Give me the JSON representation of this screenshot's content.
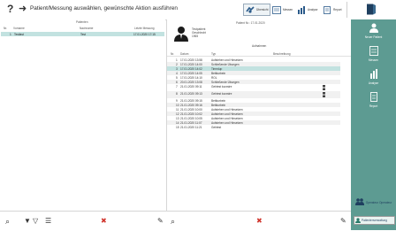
{
  "header": {
    "help_icon": "question-icon",
    "title": "Patient/Messung auswählen, gewünschte Aktion ausführen",
    "buttons": [
      {
        "label": "Übersicht",
        "icon": "handshake-icon",
        "active": true
      },
      {
        "label": "Messen",
        "icon": "measure-icon",
        "active": false
      },
      {
        "label": "Analyse",
        "icon": "bar-chart-icon",
        "active": false
      },
      {
        "label": "Report",
        "icon": "report-icon",
        "active": false
      }
    ],
    "exit_icon": "exit-icon"
  },
  "patients": {
    "header": "Patienten",
    "columns": [
      "Nr.",
      "Vorname",
      "Nachname",
      "Letzte Messung"
    ],
    "rows": [
      {
        "nr": "1",
        "vorname": "Testlast",
        "nachname": "Test",
        "letzte": "17.01.2020 17:15"
      }
    ]
  },
  "patient_detail": {
    "date": "Patient Nr.: 17.01.2020",
    "name_lines": [
      "Testpatient",
      "Geschlecht",
      "1965"
    ],
    "measurements_title": "Aufnahmen",
    "columns": [
      "Nr.",
      "Datum",
      "Typ",
      "Beschreibung"
    ],
    "rows": [
      {
        "nr": "1",
        "datum": "17.01.2020 13:58",
        "typ": "Aufstehen und Hinsetzen",
        "cam": false
      },
      {
        "nr": "2",
        "datum": "17.01.2020 14:00",
        "typ": "Schließende Übungen",
        "cam": false
      },
      {
        "nr": "3",
        "datum": "17.01.2020 14:02",
        "typ": "Timedup",
        "cam": false
      },
      {
        "nr": "4",
        "datum": "17.01.2020 14:05",
        "typ": "Bettkurbeln",
        "cam": false
      },
      {
        "nr": "5",
        "datum": "17.01.2020 14:10",
        "typ": "ROL",
        "cam": false
      },
      {
        "nr": "6",
        "datum": "20.01.2020 13:08",
        "typ": "Schließende Übungen",
        "cam": false
      },
      {
        "nr": "7",
        "datum": "21.01.2020 09:11",
        "typ": "Gehtest kurzstre",
        "cam": true
      },
      {
        "nr": "8",
        "datum": "21.01.2020 09:13",
        "typ": "Gehtest kurzstre",
        "cam": true
      },
      {
        "nr": "9",
        "datum": "21.01.2020 09:15",
        "typ": "Bettkurbeln",
        "cam": false
      },
      {
        "nr": "10",
        "datum": "21.01.2020 09:16",
        "typ": "Bettkurbeln",
        "cam": false
      },
      {
        "nr": "11",
        "datum": "21.01.2020 10:00",
        "typ": "Aufstehen und Hinsetzen",
        "cam": false
      },
      {
        "nr": "12",
        "datum": "21.01.2020 10:02",
        "typ": "Aufstehen und Hinsetzen",
        "cam": false
      },
      {
        "nr": "13",
        "datum": "21.01.2020 10:05",
        "typ": "Aufstehen und Hinsetzen",
        "cam": false
      },
      {
        "nr": "14",
        "datum": "21.01.2020 11:07",
        "typ": "Aufstehen und Hinsetzen",
        "cam": false
      },
      {
        "nr": "15",
        "datum": "21.01.2020 11:21",
        "typ": "Gehtest",
        "cam": false
      }
    ]
  },
  "sidebar": {
    "buttons": [
      {
        "label": "Neuer Patient",
        "icon": "add-patient-icon"
      },
      {
        "label": "Messen",
        "icon": "measure-icon"
      },
      {
        "label": "Analyse",
        "icon": "bar-chart-icon"
      },
      {
        "label": "Report",
        "icon": "report-icon"
      }
    ],
    "bottom": [
      {
        "label": "Operateur Operateur",
        "icon": "user-group-icon"
      },
      {
        "label": "Patientenverwaltung",
        "icon": "patient-admin-icon"
      }
    ]
  },
  "bottom_left": {
    "icons": [
      "search-icon",
      "filter-icon",
      "filter-clear-icon",
      "list-icon",
      "delete-icon",
      "edit-icon"
    ]
  },
  "bottom_right": {
    "icons": [
      "search-icon",
      "delete-icon",
      "edit-icon"
    ]
  },
  "colors": {
    "accent": "#5d9b92",
    "selection": "#c2e2e0",
    "delete": "#d0342c"
  }
}
